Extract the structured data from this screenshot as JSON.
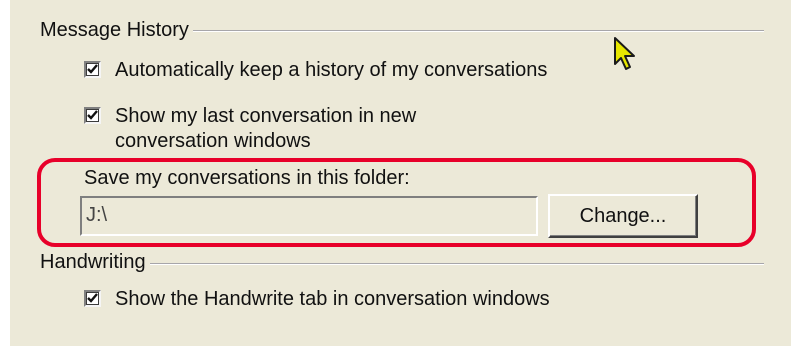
{
  "message_history": {
    "title": "Message History",
    "auto_history_label": "Automatically keep a history of my conversations",
    "auto_history_checked": true,
    "show_last_line1": "Show my last conversation in new",
    "show_last_line2": "conversation windows",
    "show_last_checked": true,
    "folder_caption": "Save my conversations in this folder:",
    "folder_path": "J:\\",
    "change_button_label": "Change..."
  },
  "handwriting": {
    "title": "Handwriting",
    "handwrite_tab_label": "Show the Handwrite tab in conversation windows",
    "handwrite_tab_checked": true
  },
  "colors": {
    "panel_background": "#ece9d8",
    "highlight_annotation": "#e8002a",
    "cursor_fill": "#e6e600"
  },
  "icons": [
    "check-icon",
    "mouse-cursor-icon"
  ]
}
